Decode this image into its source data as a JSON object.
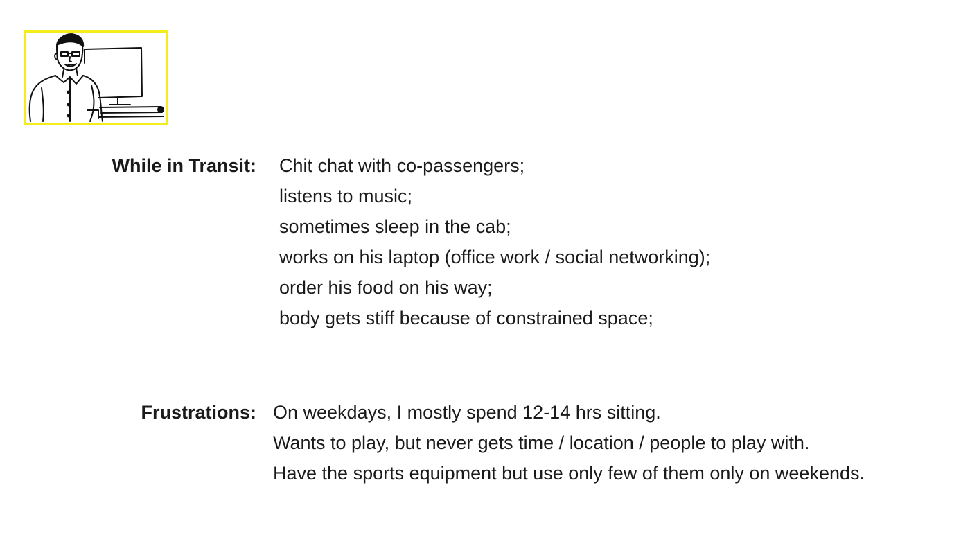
{
  "portrait": {
    "icon": "man-at-desk-sketch-icon",
    "frame_color": "#f5ec1c"
  },
  "transit": {
    "label": "While in Transit:",
    "items": [
      "Chit chat with co-passengers;",
      "listens to music;",
      "sometimes sleep in the cab;",
      "works on his laptop (office work / social networking);",
      "order his food on his way;",
      "body gets stiff because of constrained space;"
    ]
  },
  "frustrations": {
    "label": "Frustrations:",
    "items": [
      "On weekdays, I mostly spend 12-14 hrs sitting.",
      "Wants to play, but never gets time / location / people to play with.",
      "Have the sports equipment but use only few of them only on weekends."
    ]
  }
}
